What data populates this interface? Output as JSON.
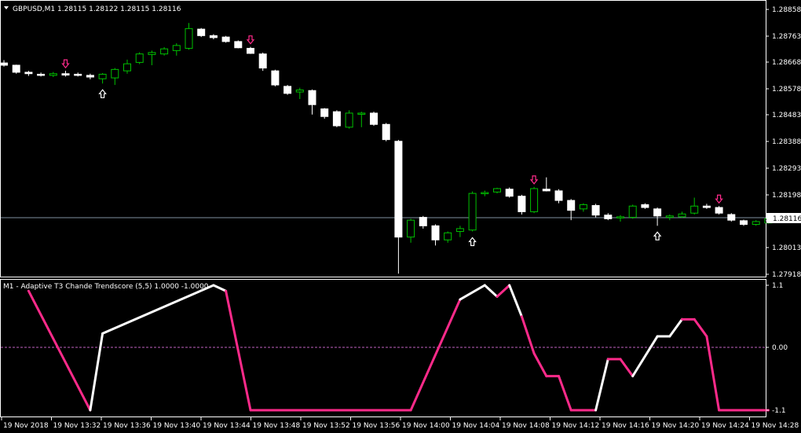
{
  "window": {
    "symbol_info": "GBPUSD,M1  1.28115 1.28122 1.28115 1.28116",
    "current_price": "1.28116",
    "sub_window_title": "M1 - Adaptive T3 Chande Trendscore (5,5) 1.0000 -1.0000"
  },
  "price_axis": {
    "ticks": [
      "1.28858",
      "1.28763",
      "1.28668",
      "1.28578",
      "1.28483",
      "1.28388",
      "1.28293",
      "1.28198",
      "1.28116",
      "1.28013",
      "1.27918"
    ]
  },
  "indicator_axis": {
    "ticks": [
      "1.1",
      "0.00",
      "-1.1"
    ]
  },
  "time_axis": {
    "labels": [
      "19 Nov 2018",
      "19 Nov 13:32",
      "19 Nov 13:36",
      "19 Nov 13:40",
      "19 Nov 13:44",
      "19 Nov 13:48",
      "19 Nov 13:52",
      "19 Nov 13:56",
      "19 Nov 14:00",
      "19 Nov 14:04",
      "19 Nov 14:08",
      "19 Nov 14:12",
      "19 Nov 14:16",
      "19 Nov 14:20",
      "19 Nov 14:24",
      "19 Nov 14:28"
    ]
  },
  "colors": {
    "background": "#000000",
    "bull_candle": "#00c000",
    "bear_candle": "#ffffff",
    "indicator_up": "#ffffff",
    "indicator_down": "#ff2a8a",
    "level_line": "#c060c0",
    "arrow_down": "#ff2a8a",
    "arrow_up": "#ffffff"
  },
  "chart_data": {
    "type": "candlestick",
    "candles": [
      {
        "o": 1.28668,
        "h": 1.28678,
        "l": 1.28655,
        "c": 1.2866
      },
      {
        "o": 1.2866,
        "h": 1.28662,
        "l": 1.2863,
        "c": 1.28635
      },
      {
        "o": 1.28635,
        "h": 1.2864,
        "l": 1.28622,
        "c": 1.2863
      },
      {
        "o": 1.28628,
        "h": 1.28634,
        "l": 1.2862,
        "c": 1.28624
      },
      {
        "o": 1.28624,
        "h": 1.28636,
        "l": 1.28618,
        "c": 1.2863
      },
      {
        "o": 1.2863,
        "h": 1.2864,
        "l": 1.2862,
        "c": 1.28625
      },
      {
        "o": 1.28628,
        "h": 1.28634,
        "l": 1.2862,
        "c": 1.28624
      },
      {
        "o": 1.28624,
        "h": 1.2863,
        "l": 1.2861,
        "c": 1.28618
      },
      {
        "o": 1.28612,
        "h": 1.28632,
        "l": 1.28595,
        "c": 1.28628
      },
      {
        "o": 1.28615,
        "h": 1.2865,
        "l": 1.2859,
        "c": 1.28645
      },
      {
        "o": 1.2864,
        "h": 1.2868,
        "l": 1.2863,
        "c": 1.28665
      },
      {
        "o": 1.2867,
        "h": 1.28706,
        "l": 1.28664,
        "c": 1.287
      },
      {
        "o": 1.28698,
        "h": 1.28712,
        "l": 1.2866,
        "c": 1.28705
      },
      {
        "o": 1.287,
        "h": 1.28724,
        "l": 1.28694,
        "c": 1.28718
      },
      {
        "o": 1.28712,
        "h": 1.28738,
        "l": 1.28694,
        "c": 1.2873
      },
      {
        "o": 1.2872,
        "h": 1.2881,
        "l": 1.28715,
        "c": 1.2879
      },
      {
        "o": 1.28788,
        "h": 1.28792,
        "l": 1.2876,
        "c": 1.28765
      },
      {
        "o": 1.28765,
        "h": 1.2877,
        "l": 1.28752,
        "c": 1.28758
      },
      {
        "o": 1.2876,
        "h": 1.28764,
        "l": 1.2874,
        "c": 1.28744
      },
      {
        "o": 1.28744,
        "h": 1.28748,
        "l": 1.2872,
        "c": 1.28722
      },
      {
        "o": 1.2872,
        "h": 1.28725,
        "l": 1.287,
        "c": 1.28702
      },
      {
        "o": 1.287,
        "h": 1.28705,
        "l": 1.2864,
        "c": 1.2865
      },
      {
        "o": 1.2864,
        "h": 1.28644,
        "l": 1.28585,
        "c": 1.2859
      },
      {
        "o": 1.28585,
        "h": 1.2859,
        "l": 1.28555,
        "c": 1.2856
      },
      {
        "o": 1.28565,
        "h": 1.2858,
        "l": 1.2854,
        "c": 1.28572
      },
      {
        "o": 1.2857,
        "h": 1.28574,
        "l": 1.28485,
        "c": 1.2852
      },
      {
        "o": 1.28505,
        "h": 1.28508,
        "l": 1.2847,
        "c": 1.28478
      },
      {
        "o": 1.28495,
        "h": 1.285,
        "l": 1.2844,
        "c": 1.28445
      },
      {
        "o": 1.2844,
        "h": 1.285,
        "l": 1.28435,
        "c": 1.2849
      },
      {
        "o": 1.2849,
        "h": 1.28495,
        "l": 1.2844,
        "c": 1.2849
      },
      {
        "o": 1.2849,
        "h": 1.28495,
        "l": 1.28445,
        "c": 1.2845
      },
      {
        "o": 1.2845,
        "h": 1.28455,
        "l": 1.2839,
        "c": 1.28396
      },
      {
        "o": 1.2839,
        "h": 1.28395,
        "l": 1.2792,
        "c": 1.2805
      },
      {
        "o": 1.2805,
        "h": 1.28115,
        "l": 1.2803,
        "c": 1.2811
      },
      {
        "o": 1.2812,
        "h": 1.28125,
        "l": 1.2808,
        "c": 1.2809
      },
      {
        "o": 1.2809,
        "h": 1.28095,
        "l": 1.2802,
        "c": 1.2804
      },
      {
        "o": 1.2804,
        "h": 1.2807,
        "l": 1.2803,
        "c": 1.28065
      },
      {
        "o": 1.2807,
        "h": 1.2809,
        "l": 1.2805,
        "c": 1.2808
      },
      {
        "o": 1.28075,
        "h": 1.28212,
        "l": 1.2807,
        "c": 1.28205
      },
      {
        "o": 1.28205,
        "h": 1.28215,
        "l": 1.28195,
        "c": 1.28208
      },
      {
        "o": 1.2821,
        "h": 1.28225,
        "l": 1.28205,
        "c": 1.28222
      },
      {
        "o": 1.2822,
        "h": 1.28226,
        "l": 1.2819,
        "c": 1.28195
      },
      {
        "o": 1.28195,
        "h": 1.282,
        "l": 1.2813,
        "c": 1.2814
      },
      {
        "o": 1.2814,
        "h": 1.28228,
        "l": 1.28135,
        "c": 1.28222
      },
      {
        "o": 1.2822,
        "h": 1.28262,
        "l": 1.28212,
        "c": 1.28214
      },
      {
        "o": 1.28214,
        "h": 1.2822,
        "l": 1.2817,
        "c": 1.2818
      },
      {
        "o": 1.2818,
        "h": 1.28185,
        "l": 1.2811,
        "c": 1.28145
      },
      {
        "o": 1.2815,
        "h": 1.2817,
        "l": 1.2814,
        "c": 1.28165
      },
      {
        "o": 1.28162,
        "h": 1.28168,
        "l": 1.2812,
        "c": 1.28128
      },
      {
        "o": 1.28128,
        "h": 1.28135,
        "l": 1.2811,
        "c": 1.28115
      },
      {
        "o": 1.28118,
        "h": 1.28128,
        "l": 1.28105,
        "c": 1.28122
      },
      {
        "o": 1.2812,
        "h": 1.28165,
        "l": 1.28115,
        "c": 1.2816
      },
      {
        "o": 1.28165,
        "h": 1.2817,
        "l": 1.2815,
        "c": 1.28155
      },
      {
        "o": 1.2815,
        "h": 1.28155,
        "l": 1.2809,
        "c": 1.28125
      },
      {
        "o": 1.2812,
        "h": 1.2813,
        "l": 1.2811,
        "c": 1.28125
      },
      {
        "o": 1.28122,
        "h": 1.2814,
        "l": 1.28118,
        "c": 1.28132
      },
      {
        "o": 1.28135,
        "h": 1.2819,
        "l": 1.2813,
        "c": 1.2816
      },
      {
        "o": 1.2816,
        "h": 1.28168,
        "l": 1.2815,
        "c": 1.28155
      },
      {
        "o": 1.28155,
        "h": 1.2816,
        "l": 1.2813,
        "c": 1.28135
      },
      {
        "o": 1.2813,
        "h": 1.28135,
        "l": 1.28105,
        "c": 1.2811
      },
      {
        "o": 1.28108,
        "h": 1.28112,
        "l": 1.2809,
        "c": 1.28095
      },
      {
        "o": 1.28095,
        "h": 1.2811,
        "l": 1.2809,
        "c": 1.28105
      },
      {
        "o": 1.281,
        "h": 1.28118,
        "l": 1.28098,
        "c": 1.28115
      }
    ],
    "signals_down": [
      5,
      20,
      43,
      58
    ],
    "signals_up": [
      8,
      38,
      53
    ],
    "indicator": {
      "ylim": [
        -1.1,
        1.1
      ],
      "level": 0,
      "points": [
        {
          "x": 2,
          "v": 1.0
        },
        {
          "x": 7,
          "v": -1.1
        },
        {
          "x": 8,
          "v": 0.25
        },
        {
          "x": 17,
          "v": 1.1
        },
        {
          "x": 18,
          "v": 1.0
        },
        {
          "x": 20,
          "v": -1.1
        },
        {
          "x": 33,
          "v": -1.1
        },
        {
          "x": 37,
          "v": 0.85
        },
        {
          "x": 39,
          "v": 1.1
        },
        {
          "x": 40,
          "v": 0.9
        },
        {
          "x": 41,
          "v": 1.1
        },
        {
          "x": 42,
          "v": 0.55
        },
        {
          "x": 43,
          "v": -0.1
        },
        {
          "x": 44,
          "v": -0.5
        },
        {
          "x": 45,
          "v": -0.5
        },
        {
          "x": 46,
          "v": -1.1
        },
        {
          "x": 48,
          "v": -1.1
        },
        {
          "x": 49,
          "v": -0.2
        },
        {
          "x": 50,
          "v": -0.2
        },
        {
          "x": 51,
          "v": -0.5
        },
        {
          "x": 53,
          "v": 0.2
        },
        {
          "x": 54,
          "v": 0.2
        },
        {
          "x": 55,
          "v": 0.5
        },
        {
          "x": 56,
          "v": 0.5
        },
        {
          "x": 57,
          "v": 0.2
        },
        {
          "x": 58,
          "v": -1.1
        },
        {
          "x": 62,
          "v": -1.1
        }
      ],
      "segment_direction": [
        "down",
        "up",
        "up",
        "up",
        "down",
        "down",
        "down",
        "up",
        "up",
        "down",
        "up",
        "down",
        "down",
        "down",
        "down",
        "down",
        "up",
        "down",
        "down",
        "up",
        "up",
        "up",
        "down",
        "down",
        "down",
        "down"
      ]
    }
  }
}
